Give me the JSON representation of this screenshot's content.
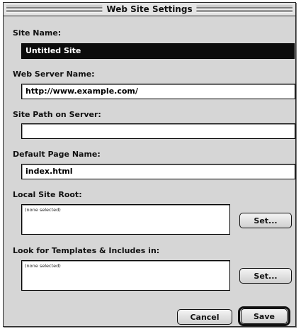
{
  "window": {
    "title": "Web Site Settings"
  },
  "site_name": {
    "label": "Site Name:",
    "value": "Untitled Site"
  },
  "web_server_name": {
    "label": "Web Server Name:",
    "value": "http://www.example.com/"
  },
  "site_path": {
    "label": "Site Path on Server:",
    "value": ""
  },
  "default_page": {
    "label": "Default Page Name:",
    "value": "index.html"
  },
  "local_site_root": {
    "label": "Local Site Root:",
    "value": "(none selected)",
    "button": "Set..."
  },
  "templates": {
    "label": "Look for Templates & Includes in:",
    "value": "(none selected)",
    "button": "Set..."
  },
  "footer": {
    "cancel": "Cancel",
    "save": "Save"
  }
}
